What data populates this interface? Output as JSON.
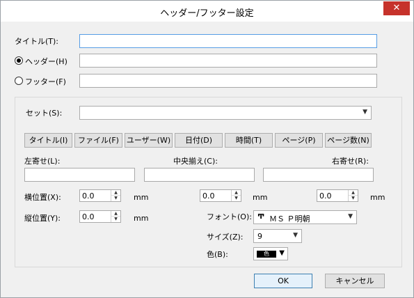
{
  "window": {
    "title": "ヘッダー/フッター設定",
    "close": "✕"
  },
  "title_row": {
    "label": "タイトル(T):",
    "value": ""
  },
  "header_row": {
    "label": "ヘッダー(H)",
    "value": ""
  },
  "footer_row": {
    "label": "フッター(F)",
    "value": ""
  },
  "set": {
    "label": "セット(S):",
    "value": ""
  },
  "insert_buttons": [
    "タイトル(I)",
    "ファイル(F)",
    "ユーザー(W)",
    "日付(D)",
    "時間(T)",
    "ページ(P)",
    "ページ数(N)"
  ],
  "align": {
    "left": "左寄せ(L):",
    "center": "中央揃え(C):",
    "right": "右寄せ(R):"
  },
  "pos": {
    "x_label": "横位置(X):",
    "y_label": "縦位置(Y):",
    "unit": "mm",
    "left_x": "0.0",
    "left_y": "0.0",
    "center_x": "0.0",
    "right_x": "0.0"
  },
  "font": {
    "label": "フォント(O):",
    "icon": "Ͳ",
    "value": "ＭＳ Ｐ明朝"
  },
  "size": {
    "label": "サイズ(Z):",
    "value": "9"
  },
  "color": {
    "label": "色(B):",
    "swatch_text": "色",
    "value": "#000000"
  },
  "buttons": {
    "ok": "OK",
    "cancel": "キャンセル"
  },
  "colors": {
    "accent": "#569de5",
    "close_bg": "#c6322b",
    "default_border": "#3c7fb1"
  }
}
